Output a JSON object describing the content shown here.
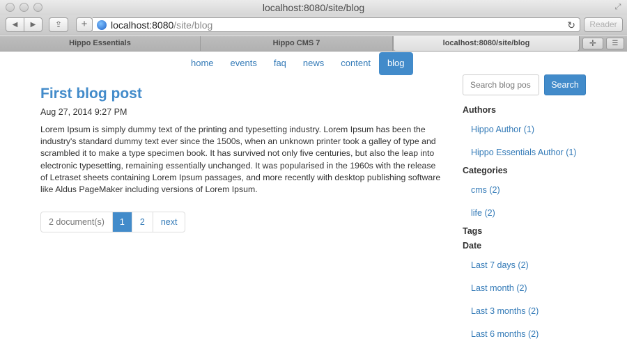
{
  "browser": {
    "window_title": "localhost:8080/site/blog",
    "url_host": "localhost:8080",
    "url_path": "/site/blog",
    "reader_label": "Reader",
    "tabs": [
      {
        "label": "Hippo Essentials"
      },
      {
        "label": "Hippo CMS 7"
      },
      {
        "label": "localhost:8080/site/blog"
      }
    ]
  },
  "nav": {
    "items": [
      {
        "label": "home"
      },
      {
        "label": "events"
      },
      {
        "label": "faq"
      },
      {
        "label": "news"
      },
      {
        "label": "content"
      },
      {
        "label": "blog",
        "active": true
      }
    ]
  },
  "post": {
    "title": "First blog post",
    "date": "Aug 27, 2014 9:27 PM",
    "body": "Lorem Ipsum is simply dummy text of the printing and typesetting industry. Lorem Ipsum has been the industry's standard dummy text ever since the 1500s, when an unknown printer took a galley of type and scrambled it to make a type specimen book. It has survived not only five centuries, but also the leap into electronic typesetting, remaining essentially unchanged. It was popularised in the 1960s with the release of Letraset sheets containing Lorem Ipsum passages, and more recently with desktop publishing software like Aldus PageMaker including versions of Lorem Ipsum."
  },
  "pagination": {
    "count_label": "2 document(s)",
    "page1": "1",
    "page2": "2",
    "next": "next",
    "current_page": 1
  },
  "sidebar": {
    "search_placeholder": "Search blog pos",
    "search_button": "Search",
    "authors_heading": "Authors",
    "authors": [
      "Hippo Author (1)",
      "Hippo Essentials Author (1)"
    ],
    "categories_heading": "Categories",
    "categories": [
      "cms (2)",
      "life (2)"
    ],
    "tags_heading": "Tags",
    "date_heading": "Date",
    "dates": [
      "Last 7 days (2)",
      "Last month (2)",
      "Last 3 months (2)",
      "Last 6 months (2)"
    ]
  },
  "colors": {
    "accent": "#428bca",
    "link": "#337ab7"
  }
}
